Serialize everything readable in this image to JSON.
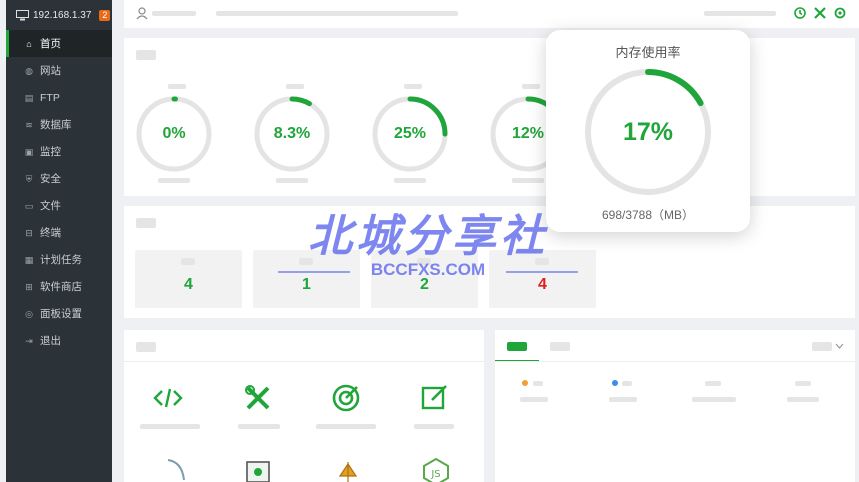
{
  "sidebar": {
    "ip": "192.168.1.37",
    "badge": "2",
    "items": [
      {
        "label": "首页",
        "icon": "home-icon"
      },
      {
        "label": "网站",
        "icon": "globe-icon"
      },
      {
        "label": "FTP",
        "icon": "ftp-icon"
      },
      {
        "label": "数据库",
        "icon": "database-icon"
      },
      {
        "label": "监控",
        "icon": "monitor-icon"
      },
      {
        "label": "安全",
        "icon": "shield-icon"
      },
      {
        "label": "文件",
        "icon": "folder-icon"
      },
      {
        "label": "终端",
        "icon": "terminal-icon"
      },
      {
        "label": "计划任务",
        "icon": "task-icon"
      },
      {
        "label": "软件商店",
        "icon": "store-icon"
      },
      {
        "label": "面板设置",
        "icon": "settings-icon"
      },
      {
        "label": "退出",
        "icon": "logout-icon"
      }
    ]
  },
  "status": {
    "gauges": [
      {
        "value": "0%",
        "fraction": 0.0
      },
      {
        "value": "8.3%",
        "fraction": 0.083
      },
      {
        "value": "25%",
        "fraction": 0.25
      },
      {
        "value": "12%",
        "fraction": 0.12
      }
    ]
  },
  "overview": {
    "counts": [
      {
        "value": "4",
        "color": "#20a53a"
      },
      {
        "value": "1",
        "color": "#20a53a"
      },
      {
        "value": "2",
        "color": "#20a53a"
      },
      {
        "value": "4",
        "color": "#e02020"
      }
    ]
  },
  "memory_popup": {
    "title": "内存使用率",
    "value": "17%",
    "fraction": 0.17,
    "detail": "698/3788（MB）"
  },
  "watermark": {
    "cn": "北城分享社",
    "en": "BCCFXS.COM"
  },
  "colors": {
    "accent": "#20a53a",
    "danger": "#e02020",
    "sidebar": "#2c3338",
    "dot_orange": "#f0a030",
    "dot_blue": "#3a8ee6"
  }
}
